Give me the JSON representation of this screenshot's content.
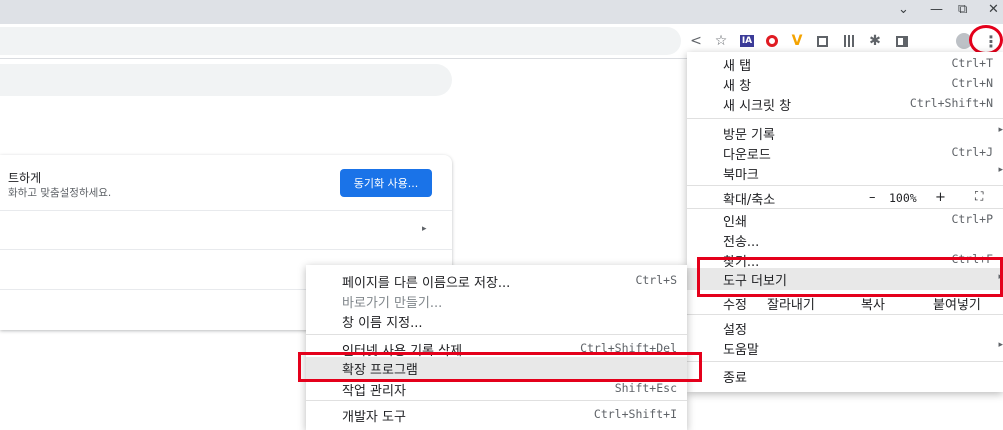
{
  "window": {
    "controls": [
      "⌄",
      "—",
      "⧉",
      "✕"
    ]
  },
  "toolbar": {
    "icons": [
      "share-icon",
      "star-icon",
      "ia-extension-icon",
      "opera-extension-icon",
      "v-extension-icon",
      "copy-extension-icon",
      "qr-extension-icon",
      "puzzle-extension-icon",
      "sidepanel-icon",
      "profile-icon",
      "kebab-menu-icon"
    ],
    "ia_label": "IA"
  },
  "page": {
    "sync_title": "트하게",
    "sync_sub": "화하고 맞춤설정하세요.",
    "sync_button": "동기화 사용..."
  },
  "main_menu": {
    "new_tab": {
      "label": "새 탭",
      "shortcut": "Ctrl+T"
    },
    "new_window": {
      "label": "새 창",
      "shortcut": "Ctrl+N"
    },
    "incognito": {
      "label": "새 시크릿 창",
      "shortcut": "Ctrl+Shift+N"
    },
    "history": {
      "label": "방문 기록"
    },
    "downloads": {
      "label": "다운로드",
      "shortcut": "Ctrl+J"
    },
    "bookmarks": {
      "label": "북마크"
    },
    "zoom": {
      "label": "확대/축소",
      "minus": "–",
      "value": "100%",
      "plus": "+",
      "fullscreen": "⛶"
    },
    "print": {
      "label": "인쇄",
      "shortcut": "Ctrl+P"
    },
    "cast": {
      "label": "전송..."
    },
    "find": {
      "label": "찾기...",
      "shortcut": "Ctrl+F"
    },
    "more_tools": {
      "label": "도구 더보기"
    },
    "edit": {
      "label": "수정",
      "cut": "잘라내기",
      "copy": "복사",
      "paste": "붙여넣기"
    },
    "settings": {
      "label": "설정"
    },
    "help": {
      "label": "도움말"
    },
    "exit": {
      "label": "종료"
    }
  },
  "sub_menu": {
    "save_as": {
      "label": "페이지를 다른 이름으로 저장...",
      "shortcut": "Ctrl+S"
    },
    "create_shortcut": {
      "label": "바로가기 만들기..."
    },
    "name_window": {
      "label": "창 이름 지정..."
    },
    "clear_data": {
      "label": "인터넷 사용 기록 삭제...",
      "shortcut": "Ctrl+Shift+Del"
    },
    "extensions": {
      "label": "확장 프로그램"
    },
    "task_manager": {
      "label": "작업 관리자",
      "shortcut": "Shift+Esc"
    },
    "dev_tools": {
      "label": "개발자 도구",
      "shortcut": "Ctrl+Shift+I"
    }
  },
  "colors": {
    "accent": "#1a73e8",
    "highlight": "#e4001b"
  }
}
